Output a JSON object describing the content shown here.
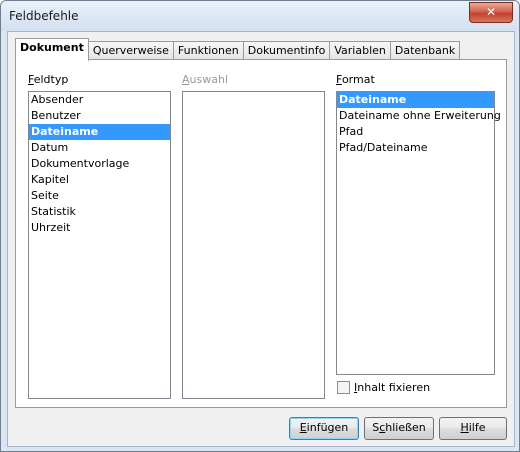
{
  "window": {
    "title": "Feldbefehle",
    "close_glyph": "✕"
  },
  "tabs": [
    {
      "label": "Dokument",
      "active": true
    },
    {
      "label": "Querverweise",
      "active": false
    },
    {
      "label": "Funktionen",
      "active": false
    },
    {
      "label": "Dokumentinfo",
      "active": false
    },
    {
      "label": "Variablen",
      "active": false
    },
    {
      "label": "Datenbank",
      "active": false
    }
  ],
  "feldtyp": {
    "label_u": "F",
    "label_rest": "eldtyp",
    "items": [
      "Absender",
      "Benutzer",
      "Dateiname",
      "Datum",
      "Dokumentvorlage",
      "Kapitel",
      "Seite",
      "Statistik",
      "Uhrzeit"
    ],
    "selected_index": 2
  },
  "auswahl": {
    "label_u": "A",
    "label_rest": "uswahl",
    "items": []
  },
  "format": {
    "label_u": "F",
    "label_rest": "ormat",
    "items": [
      "Dateiname",
      "Dateiname ohne Erweiterung",
      "Pfad",
      "Pfad/Dateiname"
    ],
    "selected_index": 0
  },
  "checkbox": {
    "label_u": "I",
    "label_rest": "nhalt fixieren",
    "checked": false
  },
  "buttons": {
    "insert": {
      "u": "E",
      "rest": "infügen"
    },
    "close": {
      "pre": "S",
      "u": "c",
      "rest": "hließen"
    },
    "help": {
      "u": "H",
      "rest": "ilfe"
    }
  }
}
